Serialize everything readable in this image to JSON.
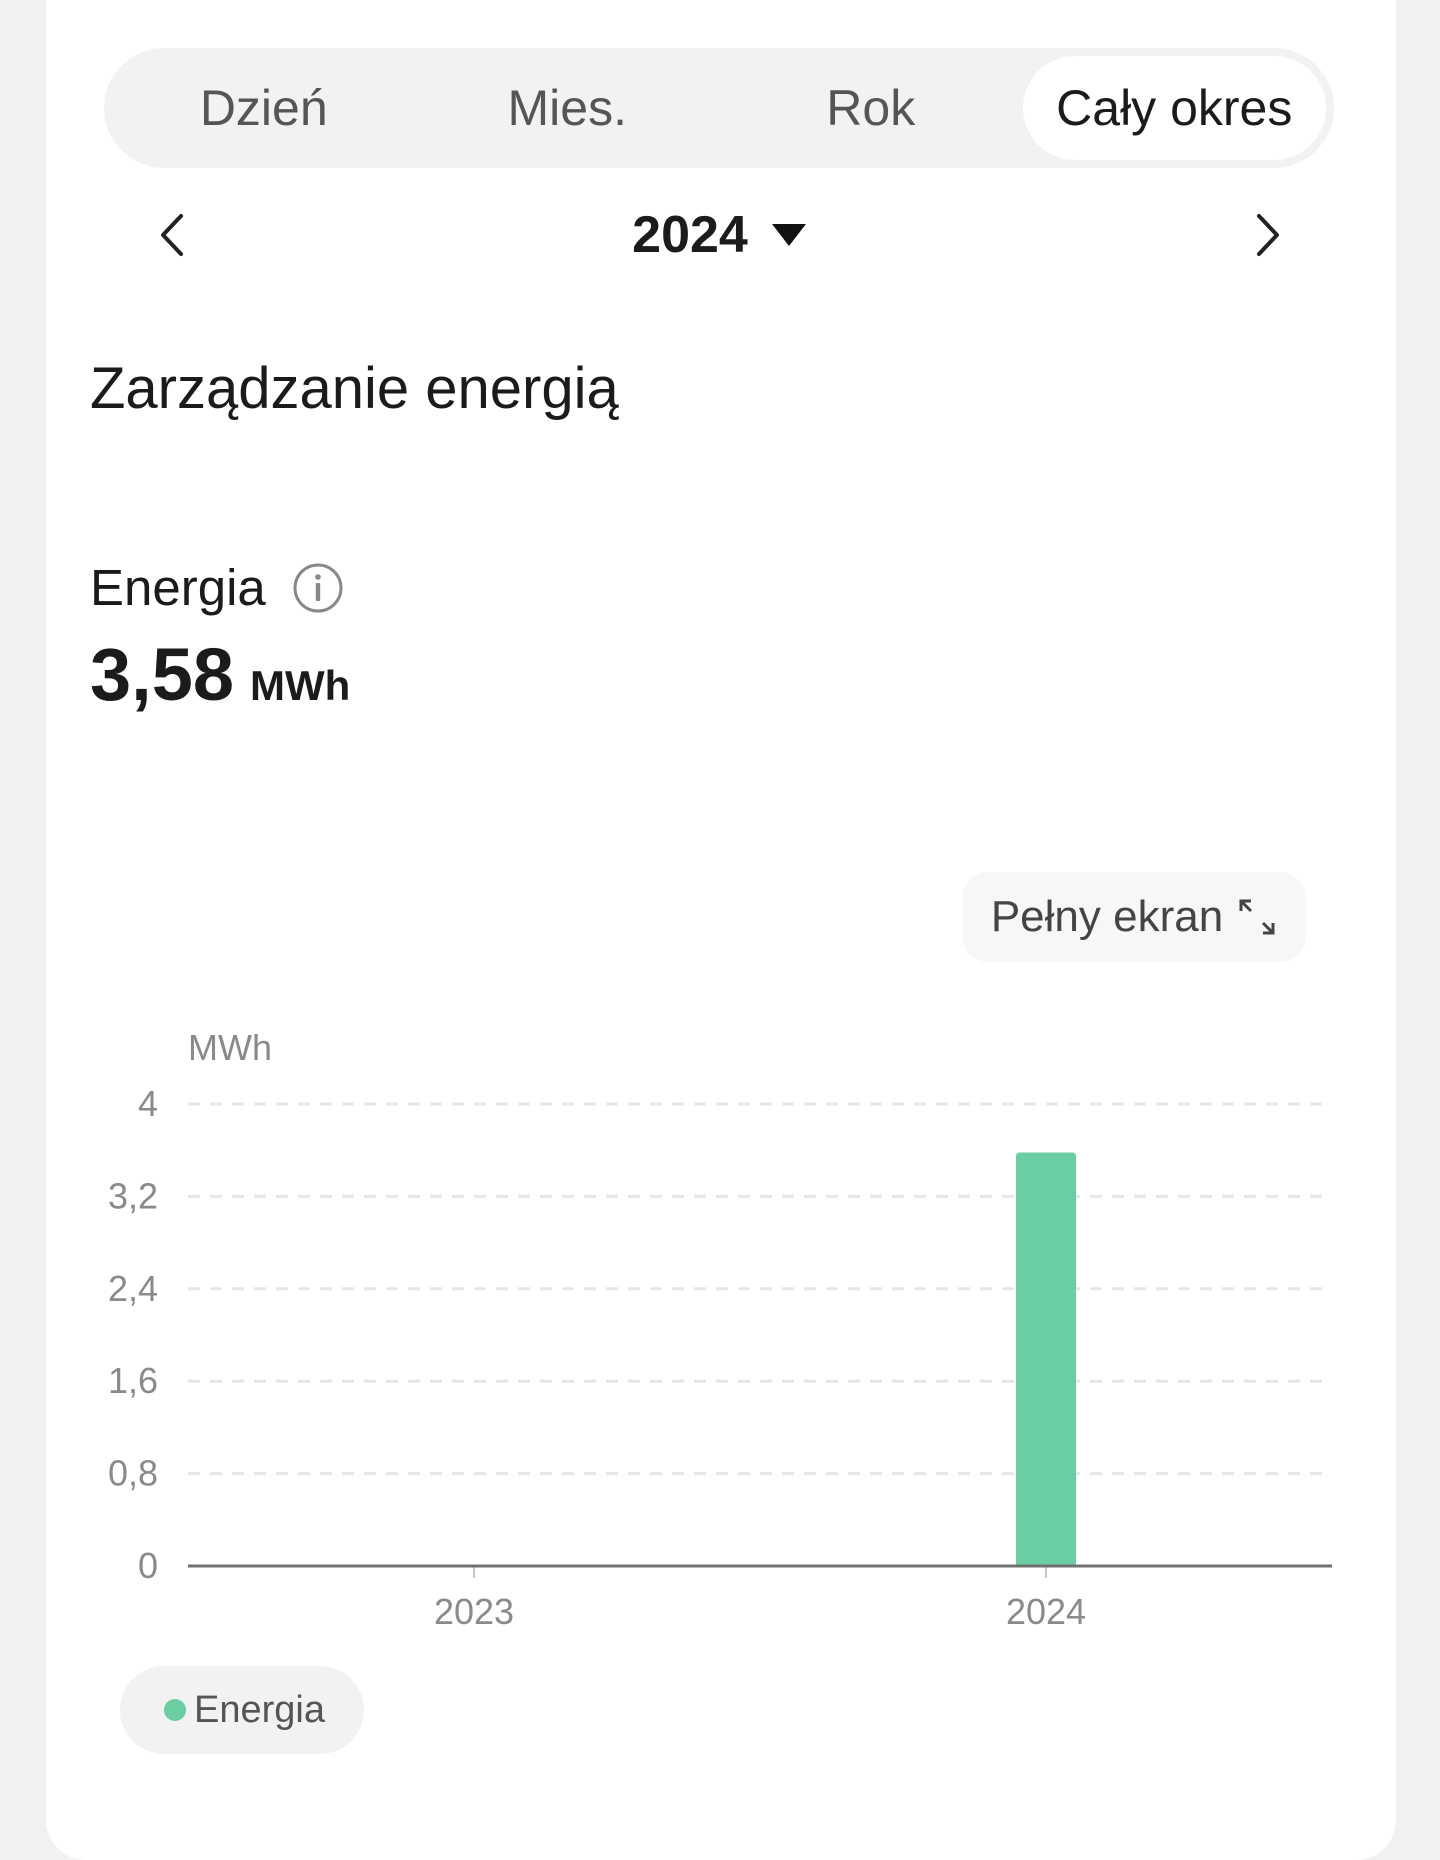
{
  "tabs": [
    {
      "label": "Dzień",
      "active": false
    },
    {
      "label": "Mies.",
      "active": false
    },
    {
      "label": "Rok",
      "active": false
    },
    {
      "label": "Cały okres",
      "active": true
    }
  ],
  "period": {
    "year": "2024"
  },
  "section_title": "Zarządzanie energią",
  "metric": {
    "label": "Energia",
    "value": "3,58",
    "unit": "MWh"
  },
  "fullscreen": {
    "label": "Pełny ekran"
  },
  "icons": {
    "prev": "chevron-left-icon",
    "next": "chevron-right-icon",
    "dropdown": "caret-down-icon",
    "info": "info-icon",
    "fullscreen": "expand-icon"
  },
  "colors": {
    "bar": "#6acea2",
    "grid": "#e3e6ea",
    "axis": "#707070"
  },
  "chart_data": {
    "type": "bar",
    "unit_label": "MWh",
    "categories": [
      "2023",
      "2024"
    ],
    "series": [
      {
        "name": "Energia",
        "values": [
          0,
          3.58
        ]
      }
    ],
    "ylim": [
      0,
      4
    ],
    "yticks": [
      0,
      0.8,
      1.6,
      2.4,
      3.2,
      4
    ],
    "ytick_labels": [
      "0",
      "0,8",
      "1,6",
      "2,4",
      "3,2",
      "4"
    ],
    "grid": true,
    "legend": "bottom-left"
  }
}
